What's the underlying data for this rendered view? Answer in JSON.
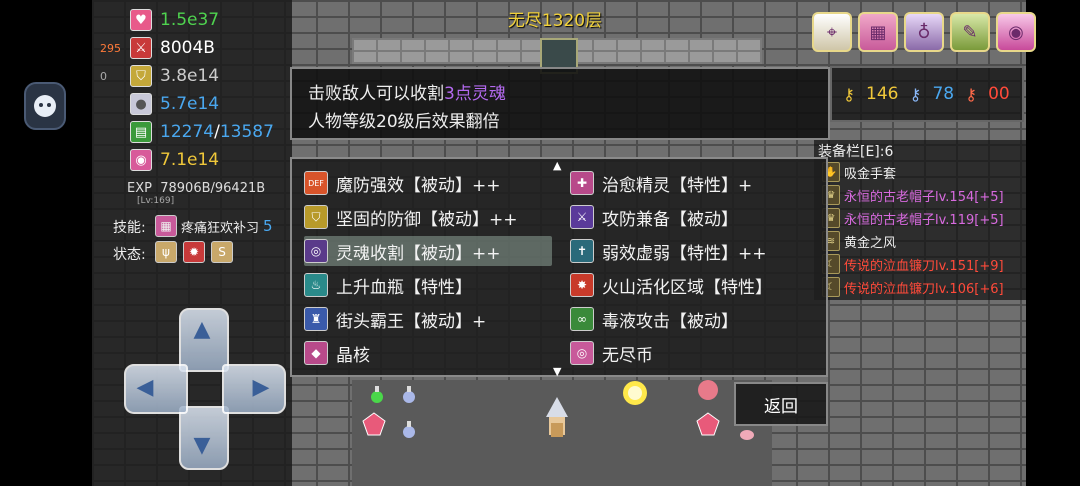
{
  "floor_title": "无尽1320层",
  "stats": [
    {
      "icon": "heart-icon",
      "glyph": "♥",
      "value": "1.5e37",
      "color": "#4fd34f",
      "bg": "#e85a8a"
    },
    {
      "icon": "sword-icon",
      "glyph": "⚔",
      "value": "8004B",
      "color": "#ffffff",
      "bg": "#c83a3a",
      "prefix": "295"
    },
    {
      "icon": "shield-icon",
      "glyph": "⛉",
      "value": "3.8e14",
      "color": "#cccccc",
      "bg": "#c4a83a",
      "prefix": "0"
    },
    {
      "icon": "orb-icon",
      "glyph": "●",
      "value": "5.7e14",
      "color": "#4aa8f0",
      "bg": "#c8c8d8"
    },
    {
      "icon": "book-icon",
      "glyph": "▤",
      "value": "12274",
      "value2": "13587",
      "color": "#4aa8f0",
      "bg": "#3a9a3a"
    },
    {
      "icon": "soul-icon",
      "glyph": "◉",
      "value": "7.1e14",
      "color": "#f0c83a",
      "bg": "#d85a9a"
    }
  ],
  "exp": {
    "label": "EXP",
    "value": "78906B/96421B",
    "level": "[Lv:169]"
  },
  "skill": {
    "label": "技能:",
    "name": "疼痛狂欢补习",
    "count": "5"
  },
  "status": {
    "label": "状态:"
  },
  "keys": [
    {
      "icon": "yellow-key-icon",
      "value": "146",
      "color": "#f0c83a"
    },
    {
      "icon": "blue-key-icon",
      "value": "78",
      "color": "#4aa8f0"
    },
    {
      "icon": "red-key-icon",
      "value": "00",
      "color": "#ff4a3a"
    }
  ],
  "equipment": {
    "title": "装备栏[E]:6",
    "items": [
      {
        "name": "吸金手套",
        "color": "#eeeeee"
      },
      {
        "name": "永恒的古老帽子lv.154[+5]",
        "color": "#d86adf"
      },
      {
        "name": "永恒的古老帽子lv.119[+5]",
        "color": "#d86adf"
      },
      {
        "name": "黄金之风",
        "color": "#eeeeee"
      },
      {
        "name": "传说的泣血镰刀lv.151[+9]",
        "color": "#ff4a3a"
      },
      {
        "name": "传说的泣血镰刀lv.106[+6]",
        "color": "#ff4a3a"
      }
    ]
  },
  "tooltip": {
    "line1_a": "击败敌人可以收割",
    "line1_b": "3点灵魂",
    "line2": "人物等级20级后效果翻倍"
  },
  "perks_left": [
    {
      "icon": "def-up-icon",
      "label": "魔防强效【被动】++",
      "bg": "#d8542a"
    },
    {
      "icon": "shield-icon",
      "label": "坚固的防御【被动】++",
      "bg": "#b89a2a"
    },
    {
      "icon": "soul-harvest-icon",
      "label": "灵魂收割【被动】++",
      "bg": "#5a3a8a"
    },
    {
      "icon": "potion-icon",
      "label": "上升血瓶【特性】",
      "bg": "#2a8a8a"
    },
    {
      "icon": "overlord-icon",
      "label": "街头霸王【被动】+",
      "bg": "#3a5aaa"
    },
    {
      "icon": "crystal-icon",
      "label": "晶核",
      "bg": "#b84a8a"
    }
  ],
  "perks_right": [
    {
      "icon": "heal-icon",
      "label": "治愈精灵【特性】+",
      "bg": "#b84a8a"
    },
    {
      "icon": "sword-shield-icon",
      "label": "攻防兼备【被动】",
      "bg": "#5a3a9a"
    },
    {
      "icon": "cross-icon",
      "label": "弱效虚弱【特性】++",
      "bg": "#2a6a7a"
    },
    {
      "icon": "volcano-icon",
      "label": "火山活化区域【特性】",
      "bg": "#c83a2a"
    },
    {
      "icon": "poison-icon",
      "label": "毒液攻击【被动】",
      "bg": "#3a8a3a"
    },
    {
      "icon": "coin-icon",
      "label": "无尽币",
      "bg": "#c85a9a"
    }
  ],
  "back_label": "返回"
}
